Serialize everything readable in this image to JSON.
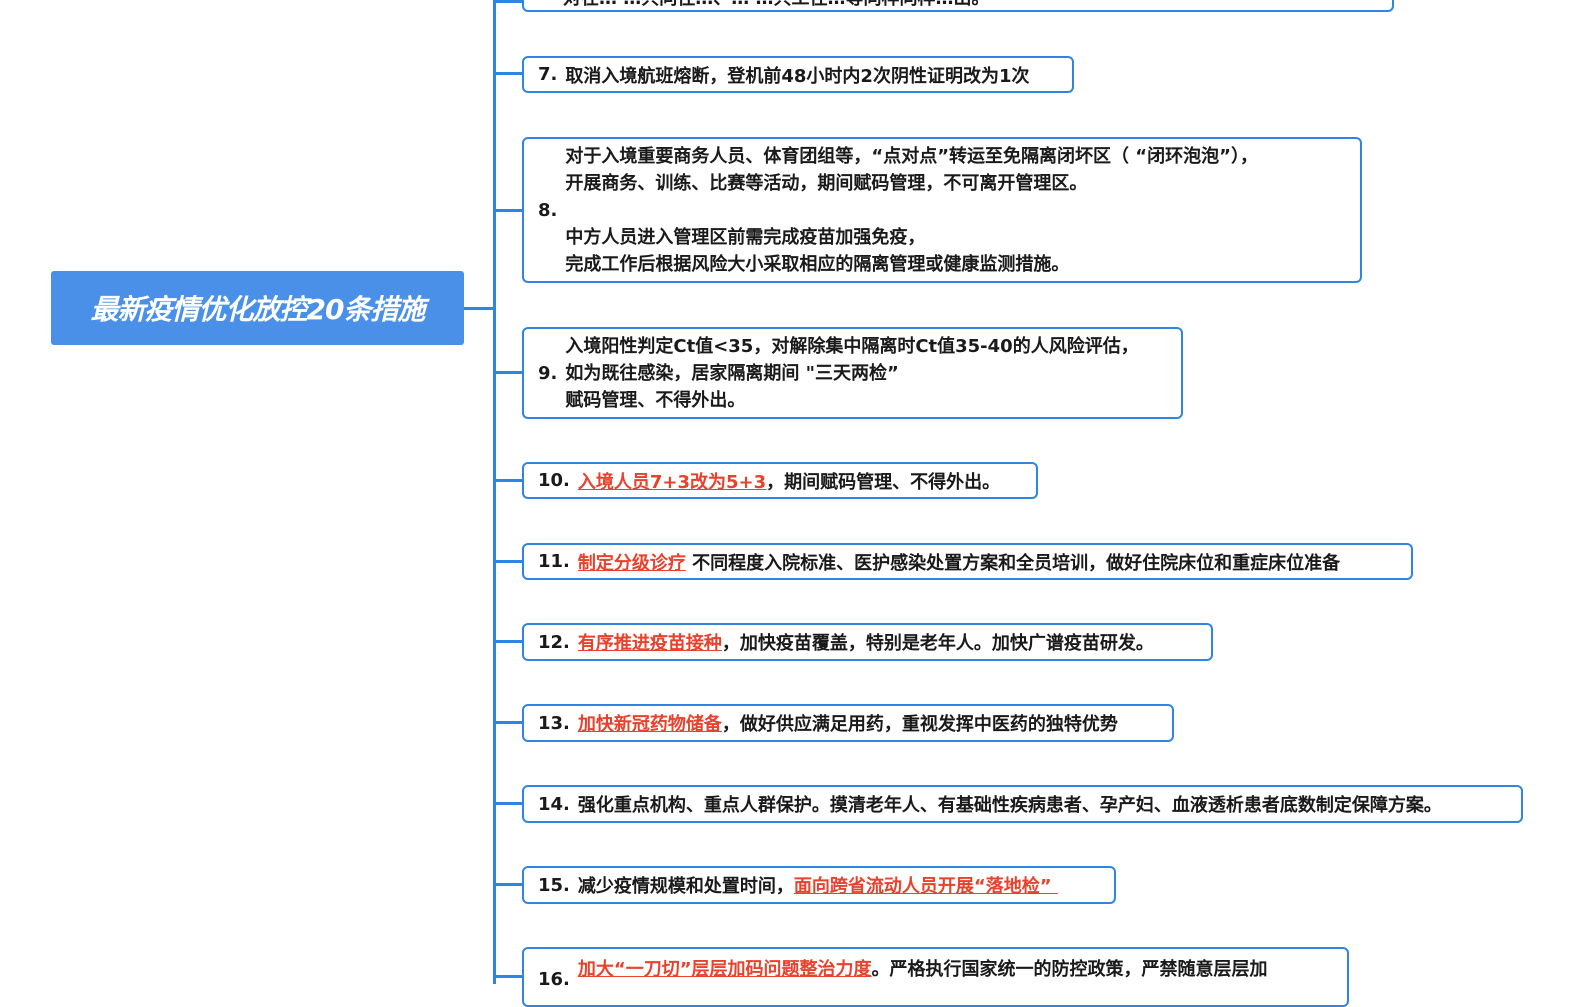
{
  "root": {
    "title": "最新疫情优化放控20条措施"
  },
  "partial_top": {
    "text": "对在… …共同往…、… …共工往…等同样同样…出。"
  },
  "items": [
    {
      "num": "7.",
      "text": "取消入境航班熔断，登机前48小时内2次阴性证明改为1次"
    },
    {
      "num": "8.",
      "lines": [
        "对于入境重要商务人员、体育团组等，“点对点”转运至免隔离闭坏区（ “闭环泡泡”），",
        "开展商务、训练、比赛等活动，期间赋码管理，不可离开管理区。",
        "中方人员进入管理区前需完成疫苗加强免疫，",
        "完成工作后根据风险大小采取相应的隔离管理或健康监测措施。"
      ]
    },
    {
      "num": "9.",
      "lines": [
        "入境阳性判定Ct值<35，对解除集中隔离时Ct值35-40的人风险评估，",
        "如为既往感染，居家隔离期间 \"三天两检”",
        "赋码管理、不得外出。"
      ]
    },
    {
      "num": "10.",
      "highlight": "入境人员7+3改为5+3",
      "rest": "，期间赋码管理、不得外出。"
    },
    {
      "num": "11.",
      "highlight": "制定分级诊疗",
      "rest": " 不同程度入院标准、医护感染处置方案和全员培训，做好住院床位和重症床位准备"
    },
    {
      "num": "12.",
      "highlight": "有序推进疫苗接种",
      "rest": "，加快疫苗覆盖，特别是老年人。加快广谱疫苗研发。"
    },
    {
      "num": "13.",
      "highlight": "加快新冠药物储备",
      "rest": "，做好供应满足用药，重视发挥中医药的独特优势"
    },
    {
      "num": "14.",
      "text": "强化重点机构、重点人群保护。摸清老年人、有基础性疾病患者、孕产妇、血液透析患者底数制定保障方案。"
    },
    {
      "num": "15.",
      "rest_before": "减少疫情规模和处置时间，",
      "highlight": "面向跨省流动人员开展“落地检” "
    },
    {
      "num": "16.",
      "highlight": "加大“一刀切”层层加码问题整治力度",
      "rest": "。严格执行国家统一的防控政策，严禁随意层层加"
    }
  ],
  "colors": {
    "accent": "#2e86e0",
    "root_bg": "#4a90e8",
    "highlight": "#e8412c"
  }
}
